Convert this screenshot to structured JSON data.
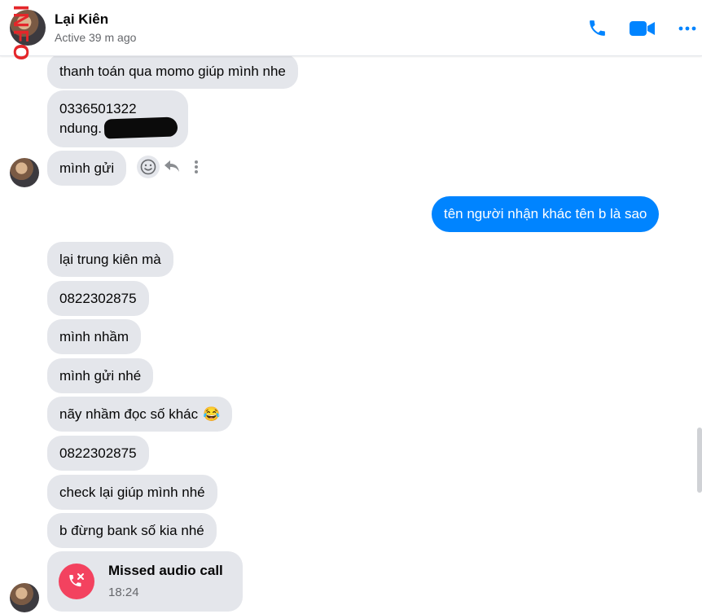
{
  "watermark": "INFO",
  "header": {
    "name": "Lại Kiên",
    "status": "Active 39 m ago",
    "icons": [
      "phone-icon",
      "video-icon",
      "more-icon"
    ],
    "accent": "#0084ff"
  },
  "messages": {
    "m1": "thanh toán qua momo giúp mình nhe",
    "m2_line1": "0336501322",
    "m2_line2": "ndung.",
    "m3": "mình gửi",
    "out1": "tên người nhận khác tên b là sao",
    "m4": "lại trung kiên mà",
    "m5": "0822302875",
    "m6": "mình nhầm",
    "m7": "mình gửi nhé",
    "m8": "nãy nhầm đọc số khác",
    "m8_emoji": "😂",
    "m9": "0822302875",
    "m10": "check lại giúp mình nhé",
    "m11": "b đừng bank số kia nhé"
  },
  "call": {
    "title": "Missed audio call",
    "time": "18:24"
  },
  "colors": {
    "incoming_bubble": "#e4e6eb",
    "outgoing_bubble": "#0084ff",
    "missed_call": "#f3425f",
    "watermark": "#e4262a"
  }
}
